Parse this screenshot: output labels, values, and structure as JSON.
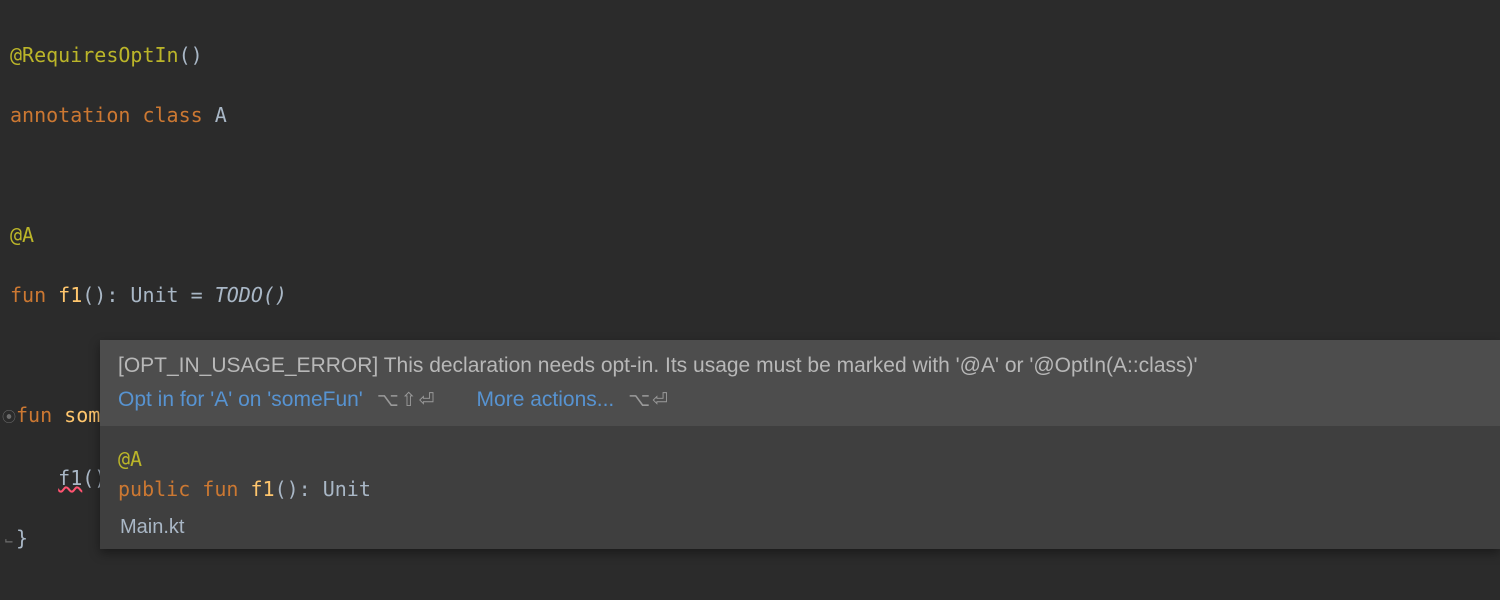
{
  "code": {
    "line1": {
      "at": "@",
      "ann": "RequiresOptIn",
      "paren": "()"
    },
    "line2": {
      "kwAnnotation": "annotation",
      "kwClass": "class",
      "name": "A"
    },
    "line3_at": "@A",
    "line4": {
      "kwFun": "fun",
      "fname": "f1",
      "sig": "(): Unit = ",
      "todo": "TODO()"
    },
    "line5": {
      "kwFun": "fun",
      "fname": "someFun",
      "sig": "() {"
    },
    "line6_call": "f1",
    "line6_paren": "()",
    "line7": "}"
  },
  "popup": {
    "message": "[OPT_IN_USAGE_ERROR] This declaration needs opt-in. Its usage must be marked with '@A' or '@OptIn(A::class)'",
    "action1": "Opt in for 'A' on 'someFun'",
    "shortcut1": "⌥⇧⏎",
    "action2": "More actions...",
    "shortcut2": "⌥⏎",
    "doc": {
      "ann": "@A",
      "kwPublic": "public",
      "kwFun": "fun",
      "fname": "f1",
      "sig": "(): Unit"
    },
    "file": "Main.kt"
  }
}
